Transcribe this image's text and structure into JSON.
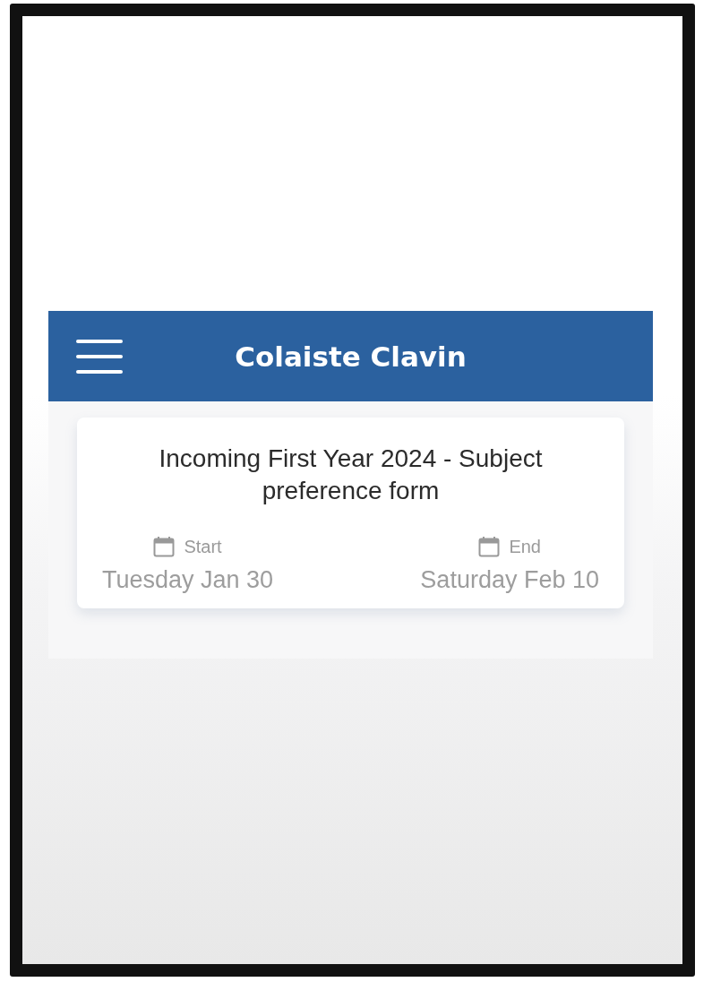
{
  "header": {
    "title": "Colaiste Clavin"
  },
  "form": {
    "title": "Incoming First Year 2024 - Subject preference form",
    "dates": [
      {
        "label": "Start",
        "value": "Tuesday Jan 30"
      },
      {
        "label": "End",
        "value": "Saturday Feb 10"
      }
    ]
  }
}
